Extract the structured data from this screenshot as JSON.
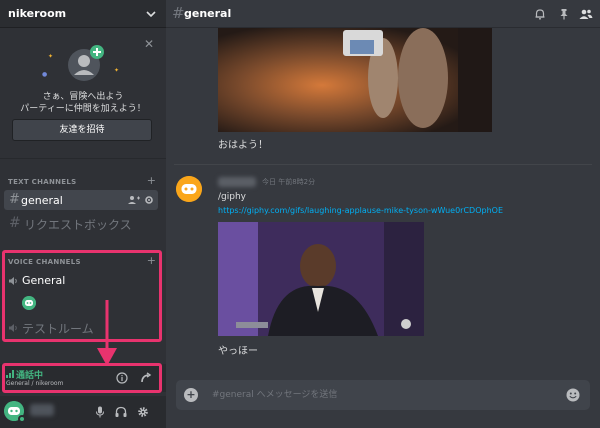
{
  "server": {
    "name": "nikeroom"
  },
  "invite": {
    "line1": "さぁ、冒険へ出よう",
    "line2": "パーティーに仲間を加えよう！",
    "button": "友達を招待",
    "close": "✕"
  },
  "categories": {
    "text": "TEXT CHANNELS",
    "voice": "VOICE CHANNELS",
    "plus": "+"
  },
  "text_channels": [
    {
      "hash": "#",
      "name": "general",
      "selected": true
    },
    {
      "hash": "#",
      "name": "リクエストボックス",
      "selected": false
    }
  ],
  "voice_channels": [
    {
      "name": "General"
    },
    {
      "name": "テストルーム"
    }
  ],
  "voice_status": {
    "status": "通話中",
    "sub": "General / nikeroom"
  },
  "header": {
    "hash": "#",
    "channel": "general"
  },
  "messages": {
    "msg1_text": "おはよう！",
    "msg2_time": "今日 午前8時2分",
    "msg2_cmd": "/giphy",
    "msg2_link": "https://giphy.com/gifs/laughing-applause-mike-tyson-wWue0rCDOphOE",
    "msg2_text": "やっほー"
  },
  "composer": {
    "placeholder": "#general へメッセージを送信",
    "plus": "+"
  },
  "colors": {
    "accent_green": "#43b581",
    "link": "#00b0f4",
    "highlight": "#e8336e",
    "avatar_orange": "#faa61a"
  }
}
